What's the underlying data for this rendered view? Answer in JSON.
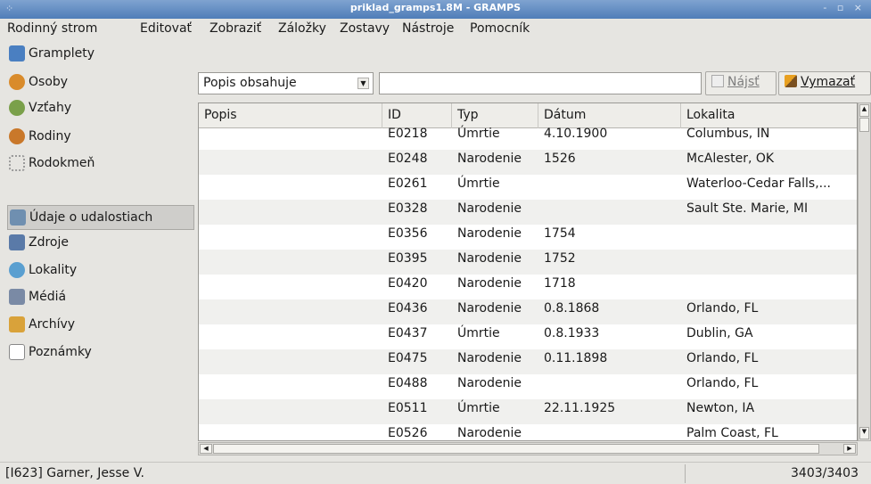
{
  "window": {
    "title": "priklad_gramps1.8M - GRAMPS",
    "controls": "- ▫ ×"
  },
  "menu": [
    "Rodinný strom",
    "Editovať",
    "Zobraziť",
    "Záložky",
    "Zostavy",
    "Nástroje",
    "Pomocník"
  ],
  "sidebar": {
    "active_index": 6,
    "items": [
      {
        "label": "Gramplety",
        "icon": "gramplets-icon",
        "color": "#4a7fc1"
      },
      {
        "label": "Osoby",
        "icon": "person-icon",
        "color": "#d98b2b"
      },
      {
        "label": "Vzťahy",
        "icon": "relationships-icon",
        "color": "#7aa04a"
      },
      {
        "label": "Rodiny",
        "icon": "families-icon",
        "color": "#c9782a"
      },
      {
        "label": "Rodokmeň",
        "icon": "pedigree-icon",
        "color": "#b0b0b0"
      },
      {
        "label": "Údaje o udalostiach",
        "icon": "events-icon",
        "color": "#6f8fb0"
      },
      {
        "label": "Zdroje",
        "icon": "sources-icon",
        "color": "#5a7aa8"
      },
      {
        "label": "Lokality",
        "icon": "places-icon",
        "color": "#5a9fd0"
      },
      {
        "label": "Médiá",
        "icon": "media-icon",
        "color": "#7a8aa5"
      },
      {
        "label": "Archívy",
        "icon": "repositories-icon",
        "color": "#d9a23a"
      },
      {
        "label": "Poznámky",
        "icon": "notes-icon",
        "color": "#e0b040"
      }
    ]
  },
  "filter": {
    "combo_value": "Popis obsahuje",
    "search_value": "",
    "find_label": "Nájsť",
    "clear_label": "Vymazať"
  },
  "table": {
    "columns": [
      "Popis",
      "ID",
      "Typ",
      "Dátum",
      "Lokalita"
    ],
    "rows": [
      [
        "",
        "E0218",
        "Úmrtie",
        "4.10.1900",
        "Columbus, IN"
      ],
      [
        "",
        "E0248",
        "Narodenie",
        "1526",
        "McAlester, OK"
      ],
      [
        "",
        "E0261",
        "Úmrtie",
        "",
        "Waterloo-Cedar Falls,..."
      ],
      [
        "",
        "E0328",
        "Narodenie",
        "",
        "Sault Ste. Marie, MI"
      ],
      [
        "",
        "E0356",
        "Narodenie",
        "1754",
        ""
      ],
      [
        "",
        "E0395",
        "Narodenie",
        "1752",
        ""
      ],
      [
        "",
        "E0420",
        "Narodenie",
        "1718",
        ""
      ],
      [
        "",
        "E0436",
        "Narodenie",
        "0.8.1868",
        "Orlando, FL"
      ],
      [
        "",
        "E0437",
        "Úmrtie",
        "0.8.1933",
        "Dublin, GA"
      ],
      [
        "",
        "E0475",
        "Narodenie",
        "0.11.1898",
        "Orlando, FL"
      ],
      [
        "",
        "E0488",
        "Narodenie",
        "",
        "Orlando, FL"
      ],
      [
        "",
        "E0511",
        "Úmrtie",
        "22.11.1925",
        "Newton, IA"
      ],
      [
        "",
        "E0526",
        "Narodenie",
        "",
        "Palm Coast, FL"
      ]
    ]
  },
  "status": {
    "left": "[I623] Garner, Jesse V.",
    "right": "3403/3403"
  }
}
